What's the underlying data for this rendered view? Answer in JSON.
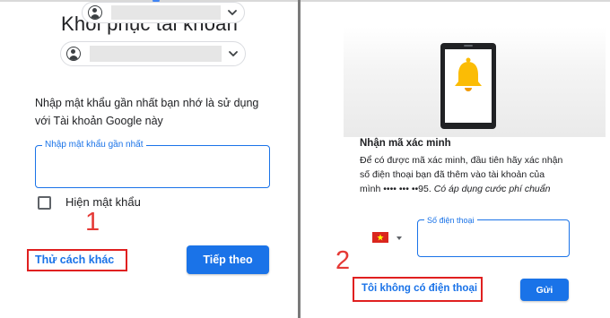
{
  "left": {
    "title": "Khôi phục tài khoản",
    "instruction": "Nhập mật khẩu gần nhất bạn nhớ là sử dụng với Tài khoản Google này",
    "password_field": {
      "label": "Nhập mật khẩu gần nhất",
      "value": ""
    },
    "show_password_label": "Hiện mật khẩu",
    "show_password_checked": false,
    "try_another_label": "Thử cách khác",
    "next_label": "Tiếp theo",
    "annotation_number": "1"
  },
  "right": {
    "heading": "Nhận mã xác minh",
    "description_text": "Để có được mã xác minh, đầu tiên hãy xác nhận số điện thoại bạn đã thêm vào tài khoản của mình •••• ••• ••95.",
    "description_note": "Có áp dụng cước phí chuẩn",
    "phone_field": {
      "label": "Số điện thoại",
      "value": ""
    },
    "no_phone_label": "Tôi không có điện thoại",
    "send_label": "Gửi",
    "annotation_number": "2"
  },
  "icons": {
    "avatar": "account-circle-icon",
    "chevron": "chevron-down-icon",
    "flag": "vietnam-flag-icon",
    "illustration": "phone-bell-illustration"
  },
  "colors": {
    "accent": "#1a73e8",
    "annotation_red": "#e53935",
    "bell": "#fbbc05"
  }
}
